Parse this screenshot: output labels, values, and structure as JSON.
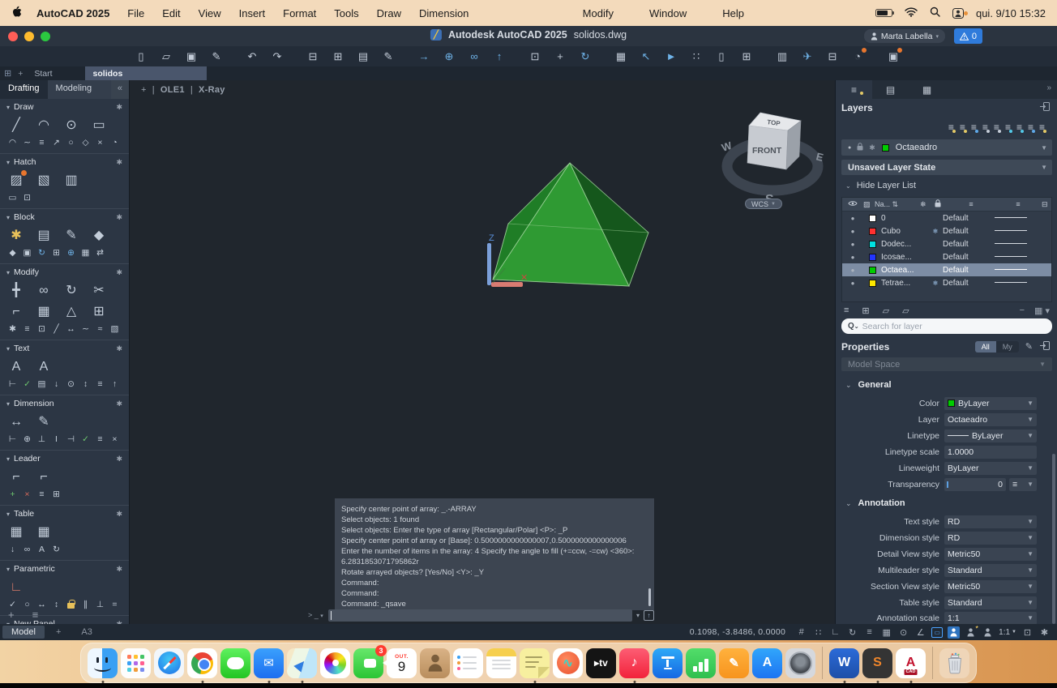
{
  "menu_bar": {
    "left_items": [
      "AutoCAD 2025",
      "File",
      "Edit",
      "View",
      "Insert",
      "Format",
      "Tools",
      "Draw",
      "Dimension"
    ],
    "right_items": [
      "Modify",
      "Window",
      "Help"
    ],
    "clock": "qui. 9/10 15:32"
  },
  "title_bar": {
    "title_app": "Autodesk AutoCAD 2025",
    "title_doc": "solidos.dwg",
    "user": "Marta Labella",
    "alert_count": "0"
  },
  "toolbar": {
    "groups": [
      [
        "new-file",
        "open-folder",
        "save",
        "save-as"
      ],
      [
        "undo",
        "redo"
      ],
      [
        "print",
        "print-add",
        "copy-sheet",
        "edit-sheet"
      ],
      [
        "import",
        "attach",
        "link",
        "export"
      ],
      [
        "zoom-window",
        "pan",
        "orbit"
      ],
      [
        "measure",
        "select-blue",
        "share-view",
        "count",
        "doc-compare",
        "hash-grid"
      ],
      [
        "palette-toggle",
        "send",
        "layout-view",
        "cloud-share"
      ],
      [
        "clipboard"
      ]
    ],
    "blue_icons": [
      "import",
      "attach",
      "link",
      "export",
      "orbit",
      "send",
      "share-view",
      "select-blue"
    ],
    "dot_icons": [
      "cloud-share",
      "clipboard"
    ]
  },
  "doc_tabs": {
    "start_label": "Start",
    "active_doc": "solidos"
  },
  "palette": {
    "tabs": [
      "Drafting",
      "Modeling"
    ],
    "collapse_icon": "«",
    "sections": [
      {
        "label": "Draw",
        "large": [
          "line",
          "arc",
          "circle",
          "rectangle"
        ],
        "small": [
          "arc-3pt",
          "polyline",
          "multiline",
          "ray",
          "ellipse",
          "polygon",
          "hatch-x",
          "revision-cloud"
        ]
      },
      {
        "label": "Hatch",
        "large": [
          "hatch",
          "hatch-pattern",
          "gradient"
        ],
        "small": [
          "boundary",
          "hatch-origin"
        ]
      },
      {
        "label": "Block",
        "large": [
          "block-create",
          "block-insert",
          "block-edit",
          "attribute-edit"
        ],
        "small": [
          "tag",
          "block-save",
          "block-sync",
          "block-base",
          "attr-sync",
          "attr-multiple",
          "block-replace"
        ]
      },
      {
        "label": "Modify",
        "large": [
          "move",
          "copy",
          "rotate",
          "trim",
          "fillet",
          "array",
          "mirror",
          "select-similar"
        ],
        "small": [
          "explode",
          "offset",
          "scale",
          "break",
          "lengthen",
          "edit-polyline",
          "edit-spline",
          "match-properties"
        ]
      },
      {
        "label": "Text",
        "large": [
          "mtext",
          "text-edit"
        ],
        "small": [
          "text-align",
          "spell-check",
          "text-frame",
          "pdf-export",
          "find-text",
          "text-scale",
          "text-justify",
          "pdf-import"
        ]
      },
      {
        "label": "Dimension",
        "large": [
          "dim-linear",
          "dim-quick"
        ],
        "small": [
          "dim-baseline",
          "dim-radius",
          "dim-ordinate",
          "dim-style",
          "dim-continue",
          "dim-update",
          "dim-space",
          "dim-break"
        ]
      },
      {
        "label": "Leader",
        "large": [
          "leader",
          "leader-edit"
        ],
        "small": [
          "leader-add",
          "leader-remove",
          "leader-align",
          "leader-collect"
        ]
      },
      {
        "label": "Table",
        "large": [
          "table",
          "table-edit"
        ],
        "small": [
          "table-export",
          "table-link",
          "table-style",
          "table-update"
        ]
      },
      {
        "label": "Parametric",
        "large": [
          "geometric-constraint"
        ],
        "small": [
          "auto-constrain",
          "coincident",
          "horizontal",
          "vertical",
          "lock-constraint",
          "parallel",
          "perpendicular",
          "equal"
        ]
      },
      {
        "label": "New Panel",
        "large": [],
        "small": []
      }
    ],
    "footer_icons": [
      "add-panel",
      "panel-list"
    ]
  },
  "glyphs": {
    "line": "╱",
    "arc": "◠",
    "circle": "⊙",
    "rectangle": "▭",
    "arc-3pt": "◠",
    "polyline": "∼",
    "multiline": "≡",
    "ray": "↗",
    "ellipse": "○",
    "polygon": "◇",
    "hatch-x": "×",
    "revision-cloud": "◔",
    "hatch": "▨",
    "hatch-pattern": "▧",
    "gradient": "▥",
    "boundary": "▭",
    "hatch-origin": "⊡",
    "block-create": "✱",
    "block-insert": "▤",
    "block-edit": "✎",
    "attribute-edit": "◆",
    "tag": "◆",
    "block-save": "▣",
    "block-sync": "↻",
    "block-base": "⊞",
    "attr-sync": "⊕",
    "attr-multiple": "▦",
    "block-replace": "⇄",
    "move": "╋",
    "copy": "∞",
    "rotate": "↻",
    "trim": "✂",
    "fillet": "⌐",
    "array": "▦",
    "mirror": "△",
    "select-similar": "⊞",
    "explode": "✱",
    "offset": "≡",
    "scale": "⊡",
    "break": "╱",
    "lengthen": "↔",
    "edit-polyline": "∼",
    "edit-spline": "≈",
    "match-properties": "▧",
    "mtext": "A",
    "text-edit": "A",
    "text-align": "⊢",
    "spell-check": "✓",
    "text-frame": "▤",
    "pdf-export": "↓",
    "find-text": "⊙",
    "text-scale": "↕",
    "text-justify": "≡",
    "pdf-import": "↑",
    "dim-linear": "↔",
    "dim-quick": "✎",
    "dim-baseline": "⊢",
    "dim-radius": "⊕",
    "dim-ordinate": "⊥",
    "dim-style": "I",
    "dim-continue": "⊣",
    "dim-update": "✓",
    "dim-space": "≡",
    "dim-break": "×",
    "leader": "⌐",
    "leader-edit": "⌐",
    "leader-add": "+",
    "leader-remove": "×",
    "leader-align": "≡",
    "leader-collect": "⊞",
    "table": "▦",
    "table-edit": "▦",
    "table-export": "↓",
    "table-link": "∞",
    "table-style": "A",
    "table-update": "↻",
    "geometric-constraint": "∟",
    "auto-constrain": "✓",
    "coincident": "○",
    "horizontal": "↔",
    "vertical": "↕",
    "parallel": "∥",
    "perpendicular": "⊥",
    "equal": "=",
    "new-file": "▯",
    "open-folder": "▱",
    "save": "▣",
    "save-as": "✎",
    "undo": "↶",
    "redo": "↷",
    "print": "⊟",
    "print-add": "⊞",
    "copy-sheet": "▤",
    "edit-sheet": "✎",
    "import": "→",
    "attach": "⊕",
    "link": "∞",
    "export": "↑",
    "zoom-window": "⊡",
    "pan": "+",
    "orbit": "↻",
    "measure": "▦",
    "select-blue": "↖",
    "share-view": "►",
    "count": "∷",
    "doc-compare": "▯",
    "hash-grid": "⊞",
    "palette-toggle": "▥",
    "send": "✈",
    "layout-view": "⊟",
    "cloud-share": "◔",
    "clipboard": "▣"
  },
  "icon_colors": {
    "geometric-constraint": "#d97b6a",
    "leader-add": "#6fc96f",
    "leader-remove": "#d96a5a",
    "dim-update": "#6fc96f",
    "spell-check": "#6fc96f",
    "block-create": "#e8c15a",
    "attr-sync": "#6fb3e8",
    "block-sync": "#6fb3e8"
  },
  "viewport": {
    "add_view_label": "+",
    "viewport_name": "OLE1",
    "visual_style": "X-Ray",
    "viewcube": {
      "top": "TOP",
      "front": "FRONT",
      "west": "W",
      "east": "E",
      "south": "S"
    },
    "wcs_label": "WCS",
    "ucs": {
      "x_label": "X",
      "z_label": "Z"
    },
    "solid_colors": {
      "face_bright": "#2f9a33",
      "face_mid": "#1f7d26",
      "face_dark": "#15571c",
      "edge": "#a5d8a0"
    }
  },
  "command_panel": {
    "lines": [
      "Specify center point of array: _.-ARRAY",
      "Select objects:   1 found",
      "Select objects: Enter the type of array [Rectangular/Polar] <P>: _P",
      "Specify center point of array or [Base]: 0.5000000000000007,0.5000000000000006",
      "Enter the number of items in the array: 4 Specify the angle to fill (+=ccw, -=cw) <360>:",
      "6.2831853071795862r",
      "Rotate arrayed objects? [Yes/No] <Y>: _Y",
      "Command:",
      "Command:",
      "Command: _qsave"
    ],
    "prompt": "> _"
  },
  "layers_panel": {
    "title": "Layers",
    "current_layer": "Octaeadro",
    "current_color": "#00cc00",
    "layer_state": "Unsaved Layer State",
    "hide_list_label": "Hide Layer List",
    "name_header": "Na...",
    "search_placeholder": "Search for layer",
    "tool_icon_dots": [
      "#e3c967",
      "#e3c967",
      "#5fa8e8",
      "#c6cdd8",
      "#c6cdd8",
      "#54c9e8",
      "#54c9e8",
      "#5fa8e8",
      "#e3c967"
    ],
    "rows": [
      {
        "name": "0",
        "color": "#ffffff",
        "frozen": false,
        "linetype": "Default",
        "selected": false
      },
      {
        "name": "Cubo",
        "color": "#ff3030",
        "frozen": true,
        "linetype": "Default",
        "selected": false
      },
      {
        "name": "Dodec...",
        "color": "#00e0e0",
        "frozen": false,
        "linetype": "Default",
        "selected": false
      },
      {
        "name": "Icosae...",
        "color": "#2235ff",
        "frozen": false,
        "linetype": "Default",
        "selected": false
      },
      {
        "name": "Octaea...",
        "color": "#00cc00",
        "frozen": false,
        "linetype": "Default",
        "selected": true
      },
      {
        "name": "Tetrae...",
        "color": "#ffe900",
        "frozen": true,
        "linetype": "Default",
        "selected": false
      }
    ]
  },
  "properties_panel": {
    "title": "Properties",
    "filters": [
      "All",
      "My"
    ],
    "active_filter": "All",
    "space_selector": "Model Space",
    "sections": [
      {
        "label": "General",
        "rows": [
          {
            "label": "Color",
            "value": "ByLayer",
            "swatch": "#00cc00",
            "dropdown": true
          },
          {
            "label": "Layer",
            "value": "Octaeadro",
            "dropdown": true
          },
          {
            "label": "Linetype",
            "value": "ByLayer",
            "linesample": true,
            "dropdown": true
          },
          {
            "label": "Linetype scale",
            "value": "1.0000",
            "dropdown": false
          },
          {
            "label": "Lineweight",
            "value": "ByLayer",
            "dropdown": true
          },
          {
            "label": "Transparency",
            "value": "0",
            "slider": true
          }
        ]
      },
      {
        "label": "Annotation",
        "rows": [
          {
            "label": "Text style",
            "value": "RD",
            "dropdown": true
          },
          {
            "label": "Dimension style",
            "value": "RD",
            "dropdown": true
          },
          {
            "label": "Detail View style",
            "value": "Metric50",
            "dropdown": true
          },
          {
            "label": "Multileader style",
            "value": "Standard",
            "dropdown": true
          },
          {
            "label": "Section View style",
            "value": "Metric50",
            "dropdown": true
          },
          {
            "label": "Table style",
            "value": "Standard",
            "dropdown": true
          },
          {
            "label": "Annotation scale",
            "value": "1:1",
            "dropdown": true
          }
        ]
      }
    ]
  },
  "status_bar": {
    "left_tabs": [
      {
        "label": "Model",
        "active": true
      },
      {
        "label": "+",
        "active": false
      },
      {
        "label": "A3",
        "active": false
      }
    ],
    "coords": "0.1098, -3.8486, 0.0000",
    "icons": [
      {
        "name": "grid-display",
        "glyph": "#"
      },
      {
        "name": "snap-mode",
        "glyph": "∷"
      },
      {
        "name": "ortho-mode",
        "glyph": "∟"
      },
      {
        "name": "polar-tracking",
        "glyph": "↻"
      },
      {
        "name": "lineweight-display",
        "glyph": "≡"
      },
      {
        "name": "transparency-display",
        "glyph": "▦"
      },
      {
        "name": "object-snap",
        "glyph": "⊙"
      },
      {
        "name": "dynamic-input",
        "glyph": "∠"
      },
      {
        "name": "selection-cycling",
        "glyph": "▭",
        "style": "frame"
      },
      {
        "name": "annotation-visibility",
        "person": true,
        "style": "fill"
      },
      {
        "name": "annotation-autoscale",
        "person": true,
        "star": true
      },
      {
        "name": "annotation-scale-person",
        "person": true
      },
      {
        "name": "annotation-scale-value",
        "text": "1:1",
        "caret": true
      },
      {
        "name": "workspace-switching",
        "glyph": "⊡"
      },
      {
        "name": "customize-gear",
        "glyph": "✱"
      }
    ]
  },
  "dock": {
    "items": [
      {
        "name": "finder",
        "type": "finder",
        "running": true
      },
      {
        "name": "launchpad",
        "type": "launchpad",
        "running": false
      },
      {
        "name": "safari",
        "type": "safari",
        "running": false
      },
      {
        "name": "chrome",
        "type": "chrome",
        "running": true
      },
      {
        "name": "messages",
        "type": "messages",
        "running": false
      },
      {
        "name": "mail",
        "type": "mail",
        "running": true
      },
      {
        "name": "maps",
        "type": "maps",
        "running": true
      },
      {
        "name": "photos",
        "type": "photos",
        "running": false
      },
      {
        "name": "facetime",
        "type": "facetime",
        "badge": "3",
        "running": false
      },
      {
        "name": "calendar",
        "type": "calendar",
        "month": "OUT.",
        "day": "9",
        "running": false
      },
      {
        "name": "contacts",
        "type": "contacts",
        "running": false
      },
      {
        "name": "reminders",
        "type": "reminders",
        "running": false
      },
      {
        "name": "notes",
        "type": "notes",
        "running": false
      },
      {
        "name": "stickies",
        "type": "stickies",
        "running": true
      },
      {
        "name": "freeform",
        "type": "freeform",
        "running": false
      },
      {
        "name": "apple-tv",
        "type": "tv",
        "label": "▸tv",
        "running": false
      },
      {
        "name": "music",
        "type": "music",
        "label": "♪",
        "running": true
      },
      {
        "name": "keynote",
        "type": "keynote",
        "running": false
      },
      {
        "name": "numbers",
        "type": "numbers",
        "running": false
      },
      {
        "name": "pages",
        "type": "pages",
        "label": "✎",
        "running": false
      },
      {
        "name": "app-store",
        "type": "appstore",
        "label": "A",
        "running": false
      },
      {
        "name": "system-settings",
        "type": "settings",
        "running": false
      },
      {
        "name": "divider",
        "type": "divider"
      },
      {
        "name": "word",
        "type": "word",
        "label": "W",
        "running": true
      },
      {
        "name": "sublime-text",
        "type": "sublime",
        "label": "S",
        "running": true
      },
      {
        "name": "autocad",
        "type": "autocad",
        "label": "A",
        "sub": "CAD",
        "running": true
      },
      {
        "name": "divider",
        "type": "divider"
      },
      {
        "name": "trash",
        "type": "trash",
        "running": false
      }
    ]
  }
}
